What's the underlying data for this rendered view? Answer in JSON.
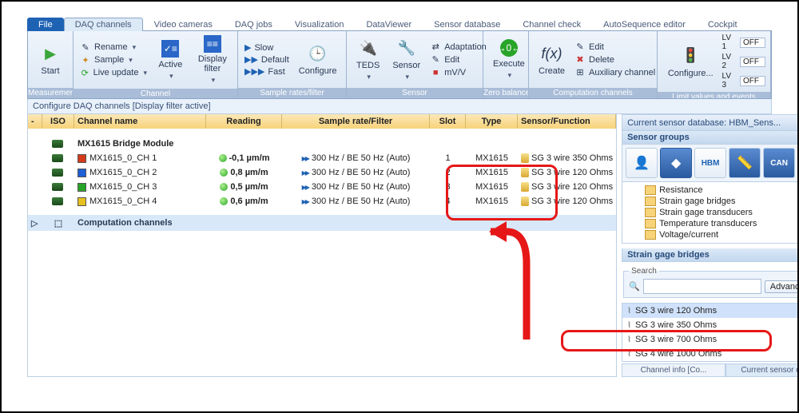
{
  "menu": {
    "file": "File",
    "tabs": [
      "DAQ channels",
      "Video cameras",
      "DAQ jobs",
      "Visualization",
      "DataViewer",
      "Sensor database",
      "Channel check",
      "AutoSequence editor",
      "Cockpit"
    ],
    "active_index": 0
  },
  "ribbon": {
    "measurement": {
      "label": "Measurement",
      "start": "Start"
    },
    "channel": {
      "label": "Channel",
      "rename": "Rename",
      "sample": "Sample",
      "live": "Live update",
      "active": "Active",
      "filter": "Display filter"
    },
    "rates": {
      "label": "Sample rates/filter",
      "slow": "Slow",
      "default": "Default",
      "fast": "Fast",
      "configure": "Configure"
    },
    "sensor": {
      "label": "Sensor",
      "teds": "TEDS",
      "sensor": "Sensor",
      "adaptation": "Adaptation",
      "edit": "Edit",
      "mvv": "mV/V"
    },
    "zero": {
      "label": "Zero balance",
      "execute": "Execute"
    },
    "comp": {
      "label": "Computation channels",
      "create": "Create",
      "edit": "Edit",
      "delete": "Delete",
      "aux": "Auxiliary channel"
    },
    "limit": {
      "label": "Limit values and events",
      "configure": "Configure...",
      "lv": [
        {
          "lbl": "LV 1",
          "val": "OFF"
        },
        {
          "lbl": "LV 2",
          "val": "OFF"
        },
        {
          "lbl": "LV 3",
          "val": "OFF"
        }
      ]
    }
  },
  "subheader": "Configure DAQ channels [Display filter active]",
  "grid": {
    "headers": {
      "iso": "ISO",
      "name": "Channel name",
      "reading": "Reading",
      "rate": "Sample rate/Filter",
      "slot": "Slot",
      "type": "Type",
      "sensor": "Sensor/Function"
    },
    "module": "MX1615 Bridge Module",
    "rows": [
      {
        "color": "#d43a1a",
        "name": "MX1615_0_CH 1",
        "reading": "-0,1 µm/m",
        "rate": "300 Hz / BE 50 Hz (Auto)",
        "slot": "1",
        "type": "MX1615",
        "sensor": "SG 3 wire 350 Ohms"
      },
      {
        "color": "#1e5fd4",
        "name": "MX1615_0_CH 2",
        "reading": "0,8 µm/m",
        "rate": "300 Hz / BE 50 Hz (Auto)",
        "slot": "2",
        "type": "MX1615",
        "sensor": "SG 3 wire 120 Ohms"
      },
      {
        "color": "#28a428",
        "name": "MX1615_0_CH 3",
        "reading": "0,5 µm/m",
        "rate": "300 Hz / BE 50 Hz (Auto)",
        "slot": "3",
        "type": "MX1615",
        "sensor": "SG 3 wire 120 Ohms"
      },
      {
        "color": "#e6c01e",
        "name": "MX1615_0_CH 4",
        "reading": "0,6 µm/m",
        "rate": "300 Hz / BE 50 Hz (Auto)",
        "slot": "4",
        "type": "MX1615",
        "sensor": "SG 3 wire 120 Ohms"
      }
    ],
    "comp_row": "Computation channels"
  },
  "side": {
    "db_title": "Current sensor database: HBM_Sens...",
    "groups_title": "Sensor groups",
    "group_icons": [
      "person",
      "diamond",
      "hbm",
      "ruler",
      "can"
    ],
    "tree": [
      "Resistance",
      "Strain gage bridges",
      "Strain gage transducers",
      "Temperature transducers",
      "Voltage/current"
    ],
    "bridges_title": "Strain gage bridges",
    "search_label": "Search",
    "advanced": "Advanced...",
    "sensors": [
      "SG 3 wire 120 Ohms",
      "SG 3 wire 350 Ohms",
      "SG 3 wire 700 Ohms",
      "SG 4 wire 1000 Ohms"
    ],
    "sensor_selected_index": 0,
    "bottom_tabs": [
      "Channel info [Co...",
      "Current sensor dat..."
    ]
  }
}
